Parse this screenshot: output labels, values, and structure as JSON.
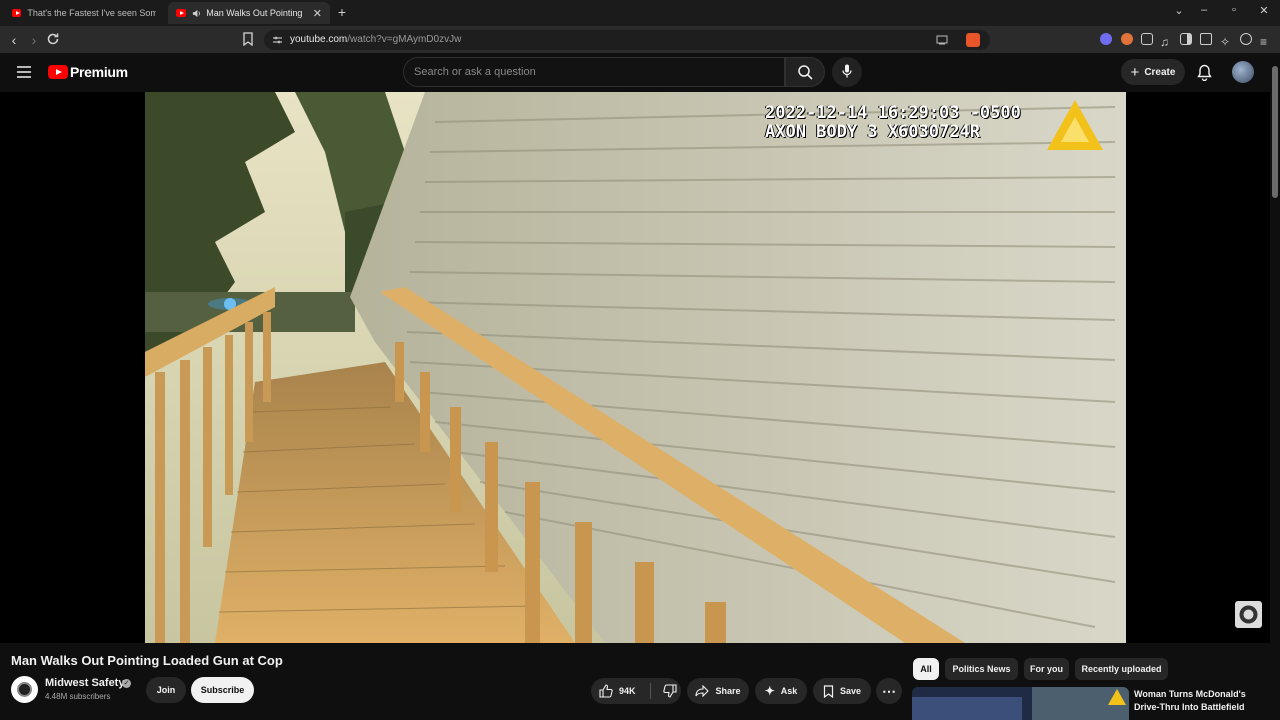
{
  "browser": {
    "tabs": [
      {
        "title": "That's the Fastest I've seen Someone",
        "active": false
      },
      {
        "title": "Man Walks Out Pointing Loade",
        "active": true
      }
    ],
    "url_host": "youtube.com",
    "url_path": "/watch?v=gMAymD0zvJw"
  },
  "header": {
    "logo_text": "Premium",
    "search_placeholder": "Search or ask a question",
    "create_label": "Create"
  },
  "video": {
    "overlay_line1": "2022-12-14 16:29:03 -0500",
    "overlay_line2": "AXON BODY 3 X6030724R",
    "title": "Man Walks Out Pointing Loaded Gun at Cop"
  },
  "channel": {
    "name": "Midwest Safety",
    "subscribers": "4.48M subscribers",
    "join_label": "Join",
    "subscribe_label": "Subscribe"
  },
  "actions": {
    "likes": "94K",
    "share_label": "Share",
    "ask_label": "Ask",
    "save_label": "Save"
  },
  "chips": [
    "All",
    "Politics News",
    "For you",
    "Recently uploaded"
  ],
  "recommended": {
    "title": "Woman Turns McDonald's Drive-Thru Into Battlefield"
  },
  "colors": {
    "brand_red": "#ff0000",
    "background": "#0f0f0f",
    "pill": "#272727"
  }
}
